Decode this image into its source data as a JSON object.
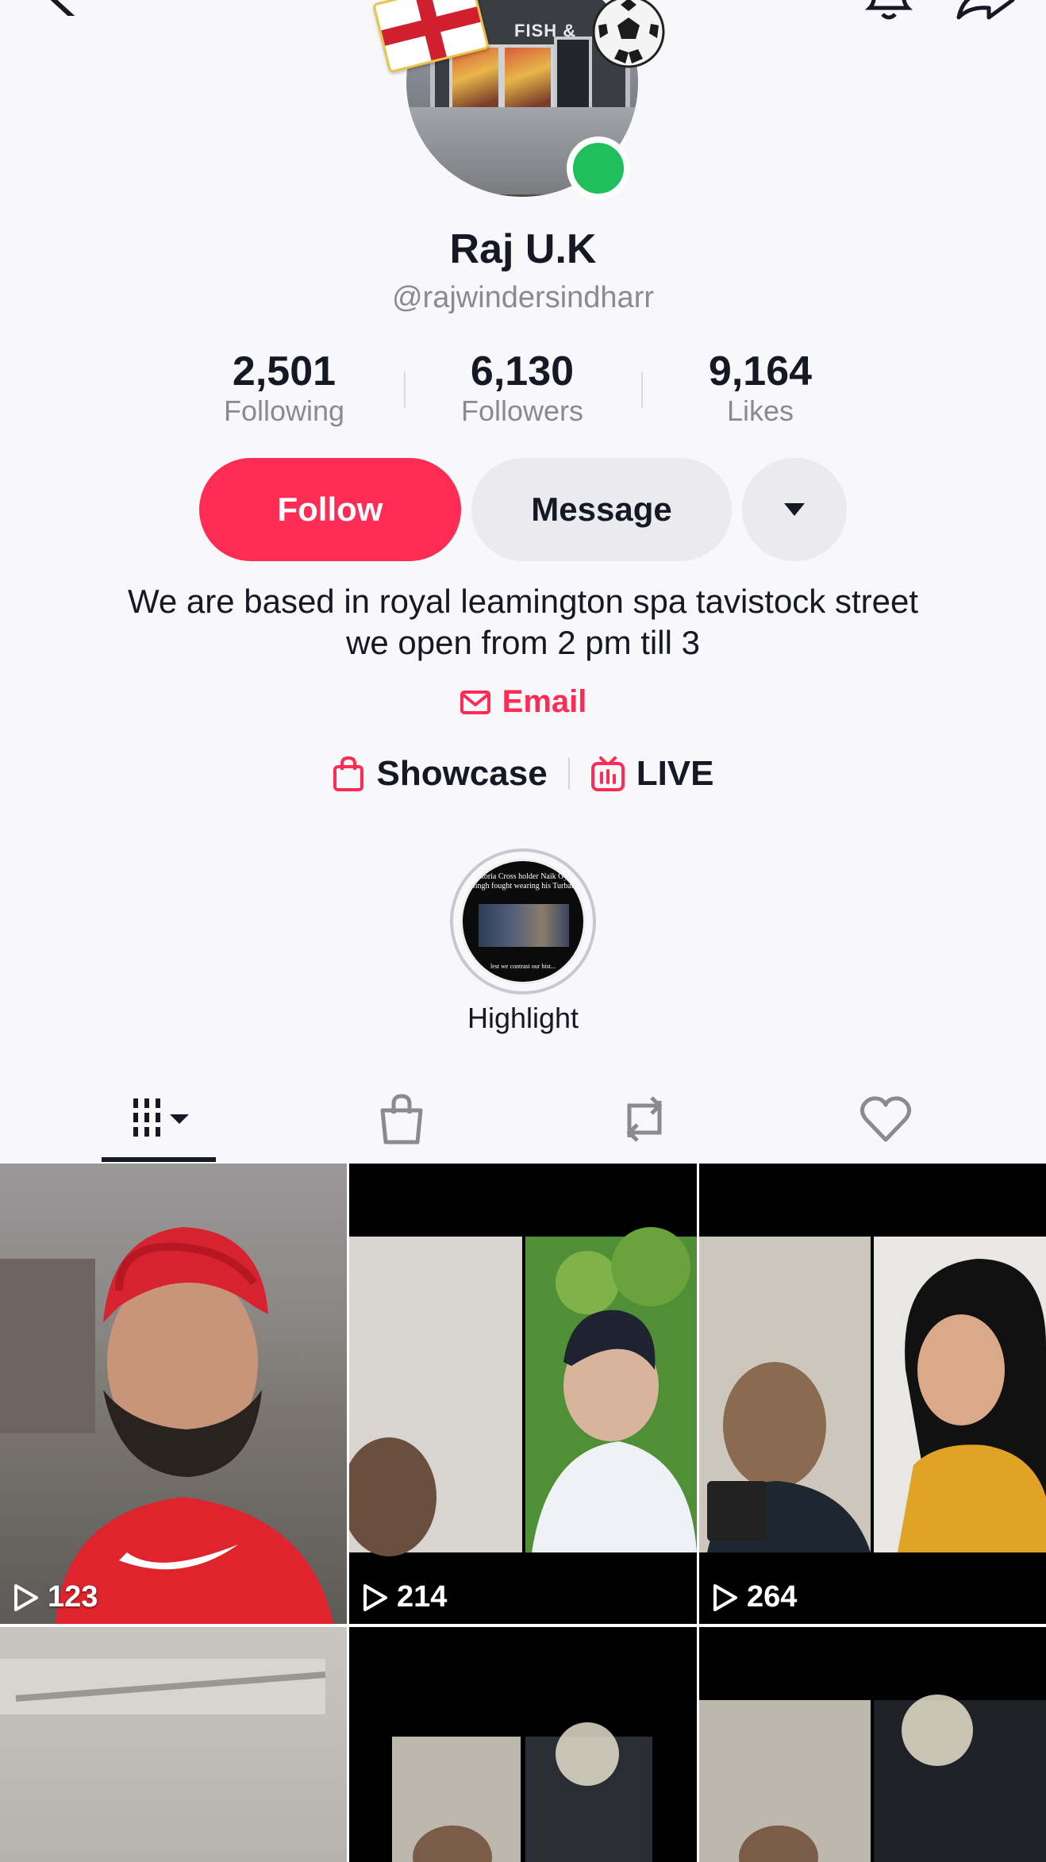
{
  "profile": {
    "display_name": "Raj U.K",
    "handle": "@rajwindersindharr",
    "avatar_sign": "FISH & KEBAB",
    "online": true
  },
  "stats": [
    {
      "value": "2,501",
      "label": "Following"
    },
    {
      "value": "6,130",
      "label": "Followers"
    },
    {
      "value": "9,164",
      "label": "Likes"
    }
  ],
  "actions": {
    "follow_label": "Follow",
    "message_label": "Message"
  },
  "bio": {
    "line1": "We are based in royal leamington spa tavistock street",
    "line2": "we open from 2 pm till 3"
  },
  "email_label": "Email",
  "links": {
    "showcase_label": "Showcase",
    "live_label": "LIVE"
  },
  "highlight": {
    "label": "Highlight",
    "thumb_title": "Victoria Cross holder Naik Gyan Singh fought wearing his Turban",
    "thumb_caption": "lest we contrast our hist..."
  },
  "tabs": [
    "videos-tab",
    "shop-tab",
    "reposts-tab",
    "liked-tab"
  ],
  "videos": [
    {
      "views": "123"
    },
    {
      "views": "214"
    },
    {
      "views": "264"
    },
    {
      "views": ""
    },
    {
      "views": ""
    },
    {
      "views": ""
    }
  ],
  "colors": {
    "accent": "#fe2c55",
    "online": "#1fbf5b",
    "text": "#161823",
    "muted": "#8a8b91"
  }
}
